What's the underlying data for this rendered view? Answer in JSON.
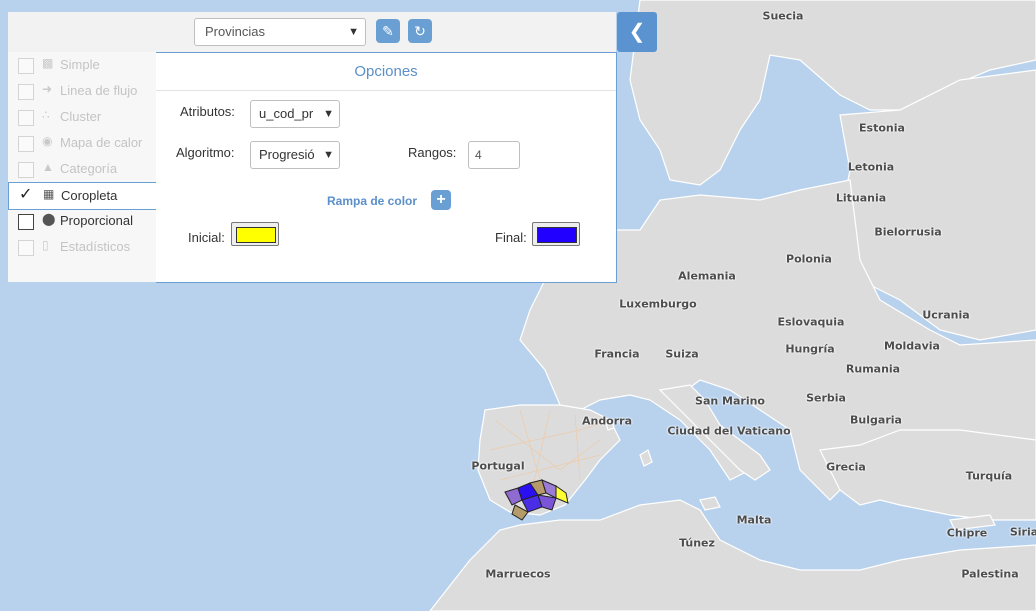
{
  "layer_select": {
    "value": "Provincias"
  },
  "tool_buttons": {
    "brush_icon": "brush-icon",
    "refresh_icon": "refresh-icon",
    "collapse_icon": "chevron-left-icon"
  },
  "types": [
    {
      "label": "Simple",
      "state": "disabled",
      "icon": "simple-icon"
    },
    {
      "label": "Linea de flujo",
      "state": "disabled",
      "icon": "arrow-right-icon"
    },
    {
      "label": "Cluster",
      "state": "disabled",
      "icon": "cluster-icon"
    },
    {
      "label": "Mapa de calor",
      "state": "disabled",
      "icon": "heatmap-icon"
    },
    {
      "label": "Categoría",
      "state": "disabled",
      "icon": "category-icon"
    },
    {
      "label": "Coropleta",
      "state": "active",
      "icon": "choropleth-icon"
    },
    {
      "label": "Proporcional",
      "state": "enabled",
      "icon": "proportional-icon"
    },
    {
      "label": "Estadísticos",
      "state": "disabled",
      "icon": "bar-chart-icon"
    }
  ],
  "options": {
    "title": "Opciones",
    "atributos_label": "Atributos:",
    "atributos_value": "u_cod_pr",
    "algoritmo_label": "Algoritmo:",
    "algoritmo_value": "Progresió",
    "rangos_label": "Rangos:",
    "rangos_value": "4",
    "rampa_label": "Rampa de color",
    "inicial_label": "Inicial:",
    "inicial_color": "#ffff00",
    "final_label": "Final:",
    "final_color": "#2200ff"
  },
  "map_labels": [
    "Suecia",
    "Estonia",
    "Letonia",
    "Lituania",
    "Bielorrusia",
    "Alemania",
    "Polonia",
    "Luxemburgo",
    "Eslovaquia",
    "Ucrania",
    "Francia",
    "Suiza",
    "Hungría",
    "Moldavia",
    "Rumania",
    "Andorra",
    "San Marino",
    "Serbia",
    "Bulgaria",
    "Ciudad del Vaticano",
    "Portugal",
    "Grecia",
    "Turquía",
    "Malta",
    "Túnez",
    "Chipre",
    "Siria",
    "Marruecos",
    "Palestina"
  ]
}
